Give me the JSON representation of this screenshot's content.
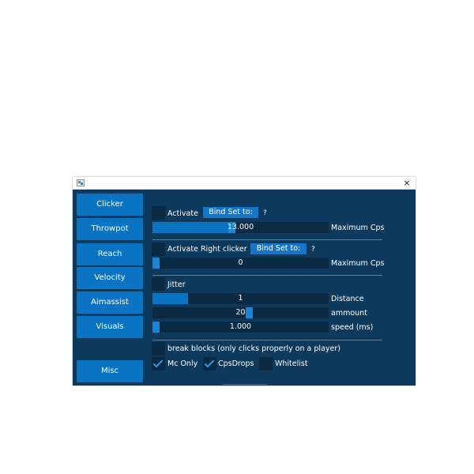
{
  "titlebar": {
    "close": "×"
  },
  "sidebar": [
    {
      "label": "Clicker"
    },
    {
      "label": "Throwpot"
    },
    {
      "label": "Reach"
    },
    {
      "label": "Velocity"
    },
    {
      "label": "Aimassist"
    },
    {
      "label": "Visuals"
    },
    {
      "label": "Misc"
    }
  ],
  "clicker": {
    "activate": {
      "label": "Activate",
      "checked": false
    },
    "bind_button": "Bind Set to:",
    "help": "?",
    "max_cps": {
      "value": "13.000",
      "label": "Maximum Cps",
      "level": 0.45
    }
  },
  "right_clicker": {
    "activate": {
      "label": "Activate Right clicker",
      "checked": false
    },
    "bind_button": "Bind Set to:",
    "help": "?",
    "max_cps": {
      "value": "0",
      "label": "Maximum Cps",
      "level": 0.0
    }
  },
  "jitter": {
    "toggle": {
      "label": "Jitter",
      "checked": false
    },
    "distance": {
      "value": "1",
      "label": "Distance",
      "level": 0.2
    },
    "ammount": {
      "value": "20",
      "label": "ammount",
      "level": 0.55
    },
    "speed": {
      "value": "1.000",
      "label": "speed (ms)",
      "level": 0.02
    }
  },
  "options": {
    "break_blocks": {
      "label": "break blocks (only clicks properly on a player)",
      "checked": false
    },
    "mc_only": {
      "label": "Mc Only",
      "checked": true
    },
    "cps_drops": {
      "label": "CpsDrops",
      "checked": true
    },
    "whitelist": {
      "label": "Whitelist",
      "checked": false
    }
  },
  "colors": {
    "panel_bg": "#0d3a5c",
    "button": "#0a73c2",
    "slider_bg": "#0a2a43",
    "check_mark": "#3b96e0"
  }
}
